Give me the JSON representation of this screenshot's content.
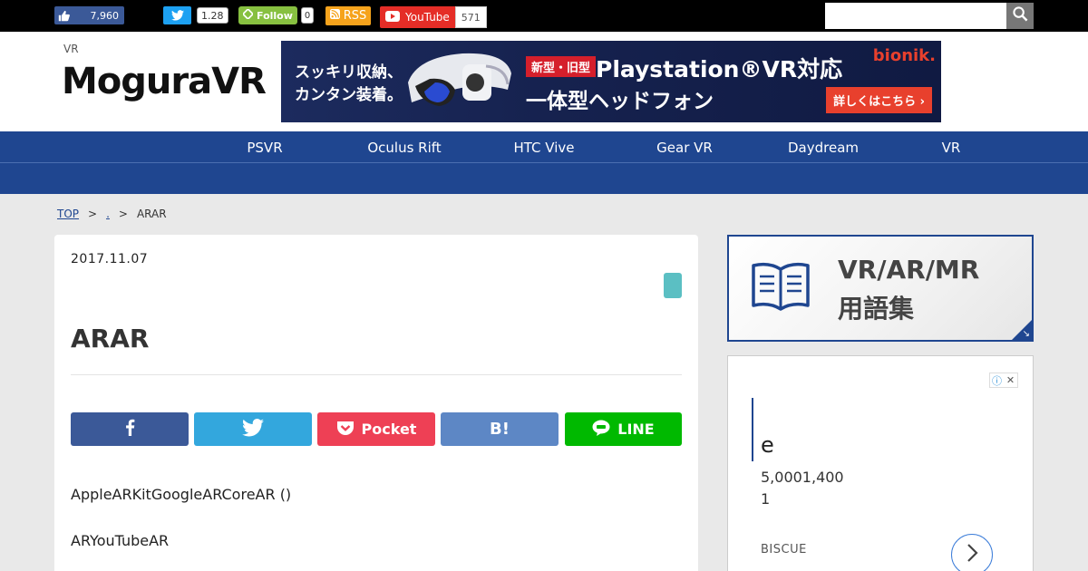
{
  "social_bar": {
    "facebook_like_count": "7,960",
    "twitter_count": "1.28",
    "feedly_label": "Follow",
    "feedly_count": "0",
    "rss_label": "RSS",
    "youtube_label": "YouTube",
    "youtube_count": "571",
    "search_placeholder": ""
  },
  "header": {
    "tagline": "VR",
    "logo": "MoguraVR",
    "banner": {
      "line1": "スッキリ収納、",
      "line2": "カンタン装着。",
      "tag": "新型・旧型",
      "headline": "Playstation®VR対応",
      "subheadline": "一体型ヘッドフォン",
      "brand": "bionik.",
      "cta": "詳しくはこちら ›"
    }
  },
  "nav": {
    "items": [
      "PSVR",
      "Oculus Rift",
      "HTC Vive",
      "Gear VR",
      "Daydream",
      "VR"
    ]
  },
  "breadcrumb": {
    "top": "TOP",
    "sep1": ">",
    "mid": ".",
    "sep2": ">",
    "current": "ARAR"
  },
  "article": {
    "date": "2017.11.07",
    "title": "ARAR",
    "share": {
      "pocket": "Pocket",
      "line": "LINE"
    },
    "paragraphs": [
      "AppleARKitGoogleARCoreAR ()",
      "ARYouTubeAR"
    ]
  },
  "sidebar": {
    "glossary_line1": "VR/AR/MR",
    "glossary_line2": "用語集",
    "ad": {
      "heading": "e",
      "text1": "5,0001,400",
      "text2": "1",
      "brand": "BISCUE"
    }
  },
  "colors": {
    "nav_blue": "#1f4690",
    "facebook": "#3b5998",
    "twitter": "#33a7dd",
    "pocket": "#ee4055",
    "hatena": "#5d87c5",
    "line": "#00b900",
    "category_tag": "#5bbfc3"
  },
  "icons": [
    "thumbs-up-icon",
    "twitter-bird-icon",
    "feedly-icon",
    "rss-icon",
    "youtube-play-icon",
    "search-icon",
    "facebook-f-icon",
    "pocket-icon",
    "hatena-b-icon",
    "line-icon",
    "book-icon",
    "adchoices-info-icon",
    "close-icon",
    "chevron-right-icon"
  ]
}
